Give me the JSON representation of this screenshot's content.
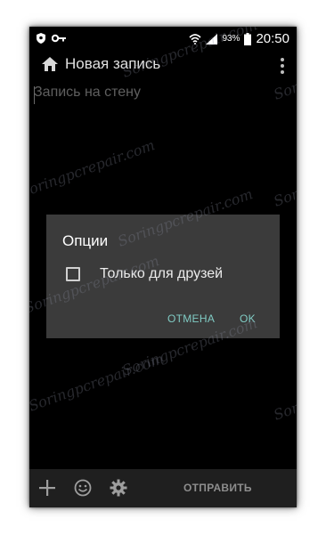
{
  "status_bar": {
    "battery_percent": "93%",
    "time": "20:50",
    "icons": [
      "shield-icon",
      "key-icon",
      "wifi-icon",
      "signal-icon",
      "battery-icon"
    ]
  },
  "app_bar": {
    "title": "Новая запись",
    "icons": [
      "home-icon",
      "more-vert-icon"
    ]
  },
  "compose": {
    "placeholder": "Запись на стену"
  },
  "dialog": {
    "title": "Опции",
    "checkbox_label": "Только для друзей",
    "checkbox_checked": false,
    "cancel_label": "ОТМЕНА",
    "ok_label": "OK"
  },
  "bottom_bar": {
    "icons": [
      "plus-icon",
      "smile-icon",
      "gear-icon"
    ],
    "send_label": "ОТПРАВИТЬ"
  },
  "watermark": "Soringpcrepair.com",
  "colors": {
    "screen_bg": "#000000",
    "dialog_bg": "#3b3b3b",
    "accent": "#80cbc4",
    "toolbar_bg": "#1f1f1f"
  }
}
